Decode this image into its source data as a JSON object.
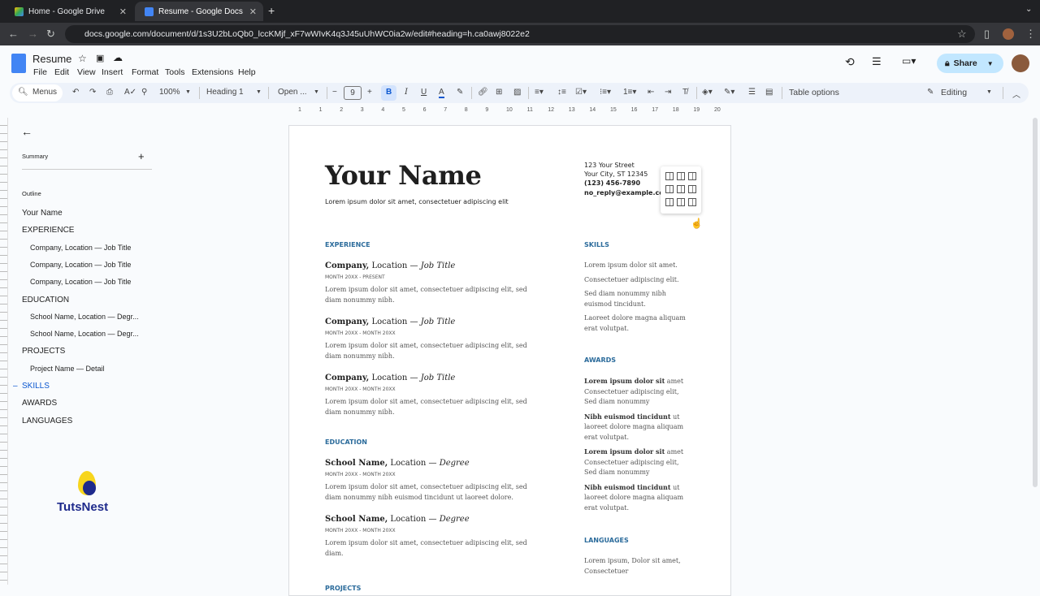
{
  "browser": {
    "tabs": [
      {
        "label": "Home - Google Drive",
        "active": false
      },
      {
        "label": "Resume - Google Docs",
        "active": true
      }
    ],
    "url": "docs.google.com/document/d/1s3U2bLoQb0_lccKMjf_xF7wWIvK4q3J45uUhWC0ia2w/edit#heading=h.ca0awj8022e2"
  },
  "doc": {
    "title": "Resume",
    "menus": [
      "File",
      "Edit",
      "View",
      "Insert",
      "Format",
      "Tools",
      "Extensions",
      "Help"
    ],
    "share_label": "Share"
  },
  "toolbar": {
    "search": "Menus",
    "zoom": "100%",
    "style": "Heading 1",
    "font": "Open ...",
    "font_size": "9",
    "table_options": "Table options",
    "mode": "Editing"
  },
  "ruler": [
    "1",
    "1",
    "2",
    "3",
    "4",
    "5",
    "6",
    "7",
    "8",
    "9",
    "10",
    "11",
    "12",
    "13",
    "14",
    "15",
    "16",
    "17",
    "18",
    "19",
    "20"
  ],
  "outline": {
    "summary_label": "Summary",
    "outline_label": "Outline",
    "items": [
      {
        "label": "Your Name",
        "level": 1
      },
      {
        "label": "EXPERIENCE",
        "level": 1
      },
      {
        "label": "Company, Location — Job Title",
        "level": 2
      },
      {
        "label": "Company, Location — Job Title",
        "level": 2
      },
      {
        "label": "Company, Location — Job Title",
        "level": 2
      },
      {
        "label": "EDUCATION",
        "level": 1
      },
      {
        "label": "School Name, Location — Degr...",
        "level": 2
      },
      {
        "label": "School Name, Location — Degr...",
        "level": 2
      },
      {
        "label": "PROJECTS",
        "level": 1
      },
      {
        "label": "Project Name — Detail",
        "level": 2
      },
      {
        "label": "SKILLS",
        "level": 1,
        "active": true
      },
      {
        "label": "AWARDS",
        "level": 1
      },
      {
        "label": "LANGUAGES",
        "level": 1
      }
    ],
    "watermark": "TutsNest"
  },
  "resume": {
    "name": "Your Name",
    "subtitle": "Lorem ipsum dolor sit amet, consectetuer adipiscing elit",
    "address": [
      "123 Your Street",
      "Your City, ST 12345",
      "(123) 456-7890",
      "no_reply@example.com"
    ],
    "experience": {
      "heading": "EXPERIENCE",
      "entries": [
        {
          "org": "Company,",
          "loc": " Location — ",
          "role": "Job Title",
          "date": "MONTH 20XX - PRESENT",
          "desc": "Lorem ipsum dolor sit amet, consectetuer adipiscing elit, sed diam nonummy nibh."
        },
        {
          "org": "Company,",
          "loc": " Location — ",
          "role": "Job Title",
          "date": "MONTH 20XX - MONTH 20XX",
          "desc": "Lorem ipsum dolor sit amet, consectetuer adipiscing elit, sed diam nonummy nibh."
        },
        {
          "org": "Company,",
          "loc": " Location — ",
          "role": "Job Title",
          "date": "MONTH 20XX - MONTH 20XX",
          "desc": "Lorem ipsum dolor sit amet, consectetuer adipiscing elit, sed diam nonummy nibh."
        }
      ]
    },
    "education": {
      "heading": "EDUCATION",
      "entries": [
        {
          "org": "School Name,",
          "loc": " Location — ",
          "role": "Degree",
          "date": "MONTH 20XX - MONTH 20XX",
          "desc": "Lorem ipsum dolor sit amet, consectetuer adipiscing elit, sed diam nonummy nibh euismod tincidunt ut laoreet dolore."
        },
        {
          "org": "School Name,",
          "loc": " Location — ",
          "role": "Degree",
          "date": "MONTH 20XX - MONTH 20XX",
          "desc": "Lorem ipsum dolor sit amet, consectetuer adipiscing elit, sed diam."
        }
      ]
    },
    "projects": {
      "heading": "PROJECTS"
    },
    "skills": {
      "heading": "SKILLS",
      "items": [
        "Lorem ipsum dolor sit amet.",
        "Consectetuer adipiscing elit.",
        "Sed diam nonummy nibh euismod tincidunt.",
        "Laoreet dolore magna aliquam erat volutpat."
      ]
    },
    "awards": {
      "heading": "AWARDS",
      "items": [
        {
          "bold": "Lorem ipsum dolor sit",
          "rest": " amet Consectetuer adipiscing elit, Sed diam nonummy"
        },
        {
          "bold": "Nibh euismod tincidunt",
          "rest": " ut laoreet dolore magna aliquam erat volutpat."
        },
        {
          "bold": "Lorem ipsum dolor sit",
          "rest": " amet Consectetuer adipiscing elit, Sed diam nonummy"
        },
        {
          "bold": "Nibh euismod tincidunt",
          "rest": " ut laoreet dolore magna aliquam erat volutpat."
        }
      ]
    },
    "languages": {
      "heading": "LANGUAGES",
      "text": "Lorem ipsum, Dolor sit amet, Consectetuer"
    }
  },
  "colors": {
    "accent": "#2b6b9b",
    "share_bg": "#c2e7ff",
    "toolbar_bg": "#edf2fa"
  }
}
